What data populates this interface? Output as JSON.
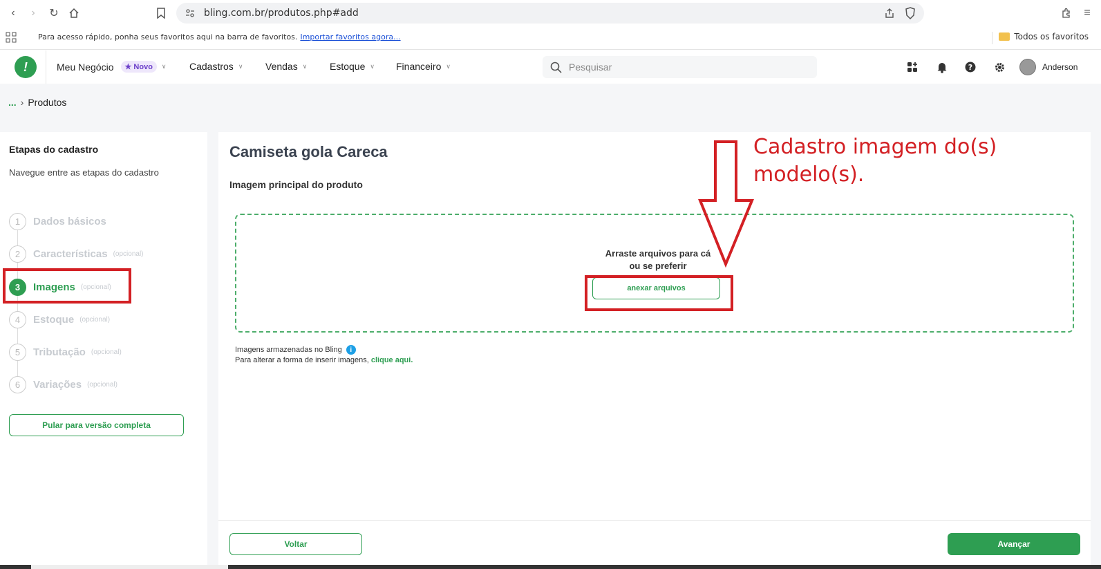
{
  "browser": {
    "url": "bling.com.br/produtos.php#add",
    "bookmarks_text": "Para acesso rápido, ponha seus favoritos aqui na barra de favoritos.",
    "bookmarks_link": "Importar favoritos agora...",
    "all_bookmarks": "Todos os favoritos"
  },
  "header": {
    "menu": [
      "Meu Negócio",
      "Cadastros",
      "Vendas",
      "Estoque",
      "Financeiro"
    ],
    "badge_novo": "Novo",
    "search_placeholder": "Pesquisar",
    "user_name": "Anderson"
  },
  "breadcrumb": {
    "ellipsis": "...",
    "current": "Produtos"
  },
  "sidebar": {
    "title": "Etapas do cadastro",
    "subtitle": "Navegue entre as etapas do cadastro",
    "steps": [
      {
        "num": "1",
        "label": "Dados básicos",
        "optional": ""
      },
      {
        "num": "2",
        "label": "Características",
        "optional": "(opcional)"
      },
      {
        "num": "3",
        "label": "Imagens",
        "optional": "(opcional)"
      },
      {
        "num": "4",
        "label": "Estoque",
        "optional": "(opcional)"
      },
      {
        "num": "5",
        "label": "Tributação",
        "optional": "(opcional)"
      },
      {
        "num": "6",
        "label": "Variações",
        "optional": "(opcional)"
      }
    ],
    "active_step": 3,
    "skip_button": "Pular para versão completa"
  },
  "main": {
    "product_title": "Camiseta gola Careca",
    "section_title": "Imagem principal do produto",
    "drop_line1": "Arraste arquivos para cá",
    "drop_line2": "ou se preferir",
    "attach_button": "anexar arquivos",
    "info_line1": "Imagens armazenadas no Bling",
    "info_line2": "Para alterar a forma de inserir imagens,",
    "info_link": "clique aqui."
  },
  "footer": {
    "back_button": "Voltar",
    "next_button": "Avançar"
  },
  "annotation": {
    "text": "Cadastro imagem do(s) modelo(s).",
    "color": "#d32024"
  },
  "colors": {
    "brand_green": "#2e9e52",
    "info_blue": "#1ea0e6",
    "badge_purple": "#6b3fc9"
  }
}
